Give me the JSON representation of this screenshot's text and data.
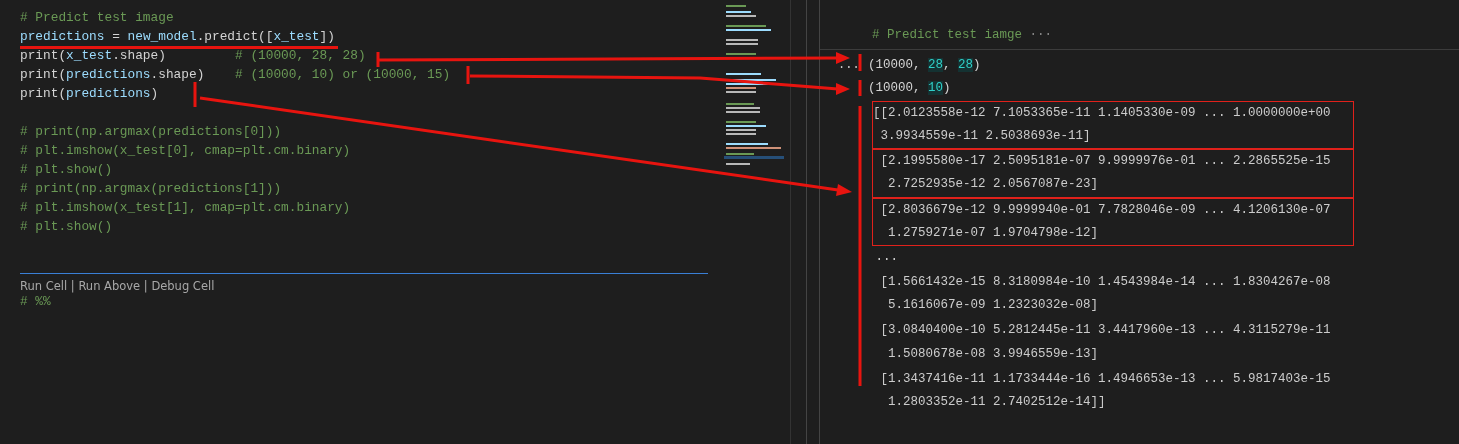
{
  "editor": {
    "lines": [
      {
        "kind": "code",
        "tokens": [
          {
            "text": "# Predict test image",
            "kind": "comment"
          }
        ]
      },
      {
        "kind": "code",
        "tokens": [
          {
            "text": "predictions",
            "kind": "var"
          },
          {
            "text": " = ",
            "kind": "plain"
          },
          {
            "text": "new_model",
            "kind": "var"
          },
          {
            "text": ".predict([",
            "kind": "plain"
          },
          {
            "text": "x_test",
            "kind": "var"
          },
          {
            "text": "])",
            "kind": "plain"
          }
        ]
      },
      {
        "kind": "code",
        "tokens": [
          {
            "text": "print(",
            "kind": "plain"
          },
          {
            "text": "x_test",
            "kind": "var"
          },
          {
            "text": ".shape)         ",
            "kind": "plain"
          },
          {
            "text": "# (10000, 28, 28)",
            "kind": "comment"
          }
        ]
      },
      {
        "kind": "code",
        "tokens": [
          {
            "text": "print(",
            "kind": "plain"
          },
          {
            "text": "predictions",
            "kind": "var"
          },
          {
            "text": ".shape)    ",
            "kind": "plain"
          },
          {
            "text": "# (10000, 10) or (10000, 15)",
            "kind": "comment"
          }
        ]
      },
      {
        "kind": "code",
        "tokens": [
          {
            "text": "print(",
            "kind": "plain"
          },
          {
            "text": "predictions",
            "kind": "var"
          },
          {
            "text": ")",
            "kind": "plain"
          }
        ]
      },
      {
        "kind": "blank"
      },
      {
        "kind": "code",
        "tokens": [
          {
            "text": "# print(np.argmax(predictions[0]))",
            "kind": "comment"
          }
        ]
      },
      {
        "kind": "code",
        "tokens": [
          {
            "text": "# plt.imshow(x_test[0], cmap=plt.cm.binary)",
            "kind": "comment"
          }
        ]
      },
      {
        "kind": "code",
        "tokens": [
          {
            "text": "# plt.show()",
            "kind": "comment"
          }
        ]
      },
      {
        "kind": "code",
        "tokens": [
          {
            "text": "# print(np.argmax(predictions[1]))",
            "kind": "comment"
          }
        ]
      },
      {
        "kind": "code",
        "tokens": [
          {
            "text": "# plt.imshow(x_test[1], cmap=plt.cm.binary)",
            "kind": "comment"
          }
        ]
      },
      {
        "kind": "code",
        "tokens": [
          {
            "text": "# plt.show()",
            "kind": "comment"
          }
        ]
      }
    ],
    "codelens": {
      "actions": [
        "Run Cell",
        "Run Above",
        "Debug Cell"
      ],
      "separator": "|"
    },
    "next_cell": {
      "tokens": [
        {
          "text": "# %%",
          "kind": "comment"
        }
      ]
    }
  },
  "output": {
    "header": {
      "text": "# Predict test iamge",
      "ellipsis": "···"
    },
    "gutter_marker": "...",
    "items": [
      {
        "kind": "line",
        "tokens": [
          {
            "text": "(10000, ",
            "kind": "plain"
          },
          {
            "text": "28",
            "kind": "number"
          },
          {
            "text": ", ",
            "kind": "plain"
          },
          {
            "text": "28",
            "kind": "number"
          },
          {
            "text": ")",
            "kind": "plain"
          }
        ]
      },
      {
        "kind": "line",
        "tokens": [
          {
            "text": "(10000, ",
            "kind": "plain"
          },
          {
            "text": "10",
            "kind": "number"
          },
          {
            "text": ")",
            "kind": "plain"
          }
        ]
      },
      {
        "kind": "array_row",
        "boxed": true,
        "lines": [
          "[[2.0123558e-12 7.1053365e-11 1.1405330e-09 ... 1.0000000e+00",
          " 3.9934559e-11 2.5038693e-11]"
        ]
      },
      {
        "kind": "array_row",
        "boxed": true,
        "lines": [
          " [2.1995580e-17 2.5095181e-07 9.9999976e-01 ... 2.2865525e-15",
          "  2.7252935e-12 2.0567087e-23]"
        ]
      },
      {
        "kind": "array_row",
        "boxed": true,
        "lines": [
          " [2.8036679e-12 9.9999940e-01 7.7828046e-09 ... 4.1206130e-07",
          "  1.2759271e-07 1.9704798e-12]"
        ]
      },
      {
        "kind": "line",
        "tokens": [
          {
            "text": " ...",
            "kind": "plain"
          }
        ]
      },
      {
        "kind": "array_row",
        "boxed": false,
        "lines": [
          " [1.5661432e-15 8.3180984e-10 1.4543984e-14 ... 1.8304267e-08",
          "  5.1616067e-09 1.2323032e-08]"
        ]
      },
      {
        "kind": "array_row",
        "boxed": false,
        "lines": [
          " [3.0840400e-10 5.2812445e-11 3.4417960e-13 ... 4.3115279e-11",
          "  1.5080678e-08 3.9946559e-13]"
        ]
      },
      {
        "kind": "array_row",
        "boxed": false,
        "lines": [
          " [1.3437416e-11 1.1733444e-16 1.4946653e-13 ... 5.9817403e-15",
          "  1.2803352e-11 2.7402512e-14]]"
        ]
      }
    ]
  }
}
